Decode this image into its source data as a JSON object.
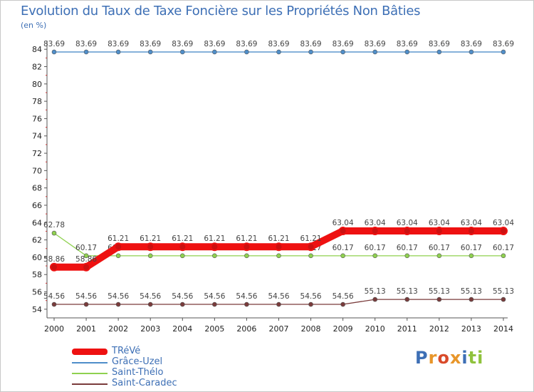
{
  "title": "Evolution du Taux de Taxe Foncière sur les Propriétés Non Bâties",
  "unit_label": "(en %)",
  "chart_data": {
    "type": "line",
    "title": "Evolution du Taux de Taxe Foncière sur les Propriétés Non Bâties",
    "ylabel": "(en %)",
    "xlabel": "",
    "x": [
      "2000",
      "2001",
      "2002",
      "2003",
      "2004",
      "2005",
      "2006",
      "2007",
      "2008",
      "2009",
      "2010",
      "2011",
      "2012",
      "2013",
      "2014"
    ],
    "ylim": [
      53,
      85
    ],
    "yticks": [
      54,
      56,
      58,
      60,
      62,
      64,
      66,
      68,
      70,
      72,
      74,
      76,
      78,
      80,
      82,
      84
    ],
    "grid": false,
    "legend_position": "bottom-left",
    "series": [
      {
        "name": "Grâce-Uzel",
        "color": "#4f8ec9",
        "values": [
          83.69,
          83.69,
          83.69,
          83.69,
          83.69,
          83.69,
          83.69,
          83.69,
          83.69,
          83.69,
          83.69,
          83.69,
          83.69,
          83.69,
          83.69
        ],
        "labels": [
          "83.69",
          "83.69",
          "83.69",
          "83.69",
          "83.69",
          "83.69",
          "83.69",
          "83.69",
          "83.69",
          "83.69",
          "83.69",
          "83.69",
          "83.69",
          "83.69",
          "83.69"
        ]
      },
      {
        "name": "Saint-Thélo",
        "color": "#8fd14f",
        "values": [
          62.78,
          60.17,
          60.17,
          60.17,
          60.17,
          60.17,
          60.17,
          60.17,
          60.17,
          60.17,
          60.17,
          60.17,
          60.17,
          60.17,
          60.17
        ],
        "labels": [
          "62.78",
          "60.17",
          "60.17",
          "60.17",
          "60.17",
          "60.17",
          "60.17",
          "60.17",
          "60.17",
          "60.17",
          "60.17",
          "60.17",
          "60.17",
          "60.17",
          "60.17"
        ]
      },
      {
        "name": "Saint-Caradec",
        "color": "#7a3b3b",
        "values": [
          54.56,
          54.56,
          54.56,
          54.56,
          54.56,
          54.56,
          54.56,
          54.56,
          54.56,
          54.56,
          55.13,
          55.13,
          55.13,
          55.13,
          55.13
        ],
        "labels": [
          "54.56",
          "54.56",
          "54.56",
          "54.56",
          "54.56",
          "54.56",
          "54.56",
          "54.56",
          "54.56",
          "54.56",
          "55.13",
          "55.13",
          "55.13",
          "55.13",
          "55.13"
        ]
      },
      {
        "name": "TRéVé",
        "color": "#ee1111",
        "values": [
          58.86,
          58.86,
          61.21,
          61.21,
          61.21,
          61.21,
          61.21,
          61.21,
          61.21,
          63.04,
          63.04,
          63.04,
          63.04,
          63.04,
          63.04
        ],
        "labels": [
          "58.86",
          "58.86",
          "61.21",
          "61.21",
          "61.21",
          "61.21",
          "61.21",
          "61.21",
          "61.21",
          "63.04",
          "63.04",
          "63.04",
          "63.04",
          "63.04",
          "63.04"
        ]
      }
    ]
  },
  "legend": [
    {
      "name": "TRéVé",
      "color": "#ee1111"
    },
    {
      "name": "Grâce-Uzel",
      "color": "#4f8ec9"
    },
    {
      "name": "Saint-Thélo",
      "color": "#8fd14f"
    },
    {
      "name": "Saint-Caradec",
      "color": "#7a3b3b"
    }
  ],
  "logo": {
    "text": "Proxiti",
    "colors": [
      "#3d6fb5",
      "#e8962a",
      "#d94a2a",
      "#e8962a",
      "#3d6fb5",
      "#8fc23c",
      "#8fc23c"
    ]
  }
}
